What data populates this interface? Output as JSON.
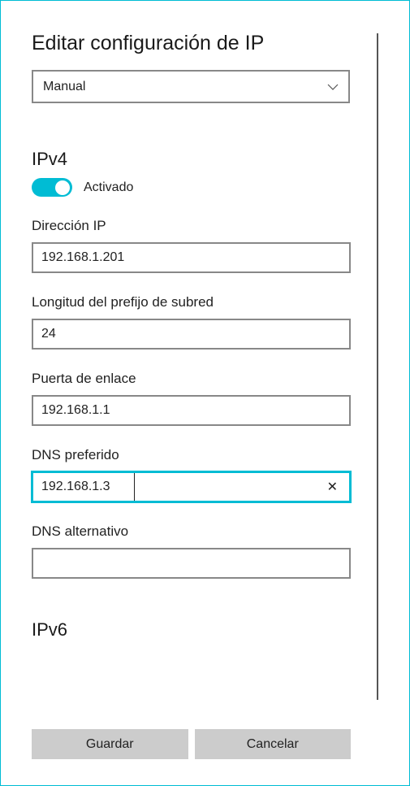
{
  "title": "Editar configuración de IP",
  "mode_select": {
    "selected": "Manual"
  },
  "ipv4": {
    "heading": "IPv4",
    "toggle": {
      "on_label": "Activado",
      "state": true
    },
    "fields": {
      "ip": {
        "label": "Dirección IP",
        "value": "192.168.1.201"
      },
      "prefix": {
        "label": "Longitud del prefijo de subred",
        "value": "24"
      },
      "gateway": {
        "label": "Puerta de enlace",
        "value": "192.168.1.1"
      },
      "dns1": {
        "label": "DNS preferido",
        "value": "192.168.1.3",
        "focused": true
      },
      "dns2": {
        "label": "DNS alternativo",
        "value": ""
      }
    }
  },
  "ipv6": {
    "heading": "IPv6"
  },
  "buttons": {
    "save": "Guardar",
    "cancel": "Cancelar"
  },
  "colors": {
    "accent": "#00BCD4",
    "border": "#888888",
    "button_bg": "#cccccc"
  }
}
